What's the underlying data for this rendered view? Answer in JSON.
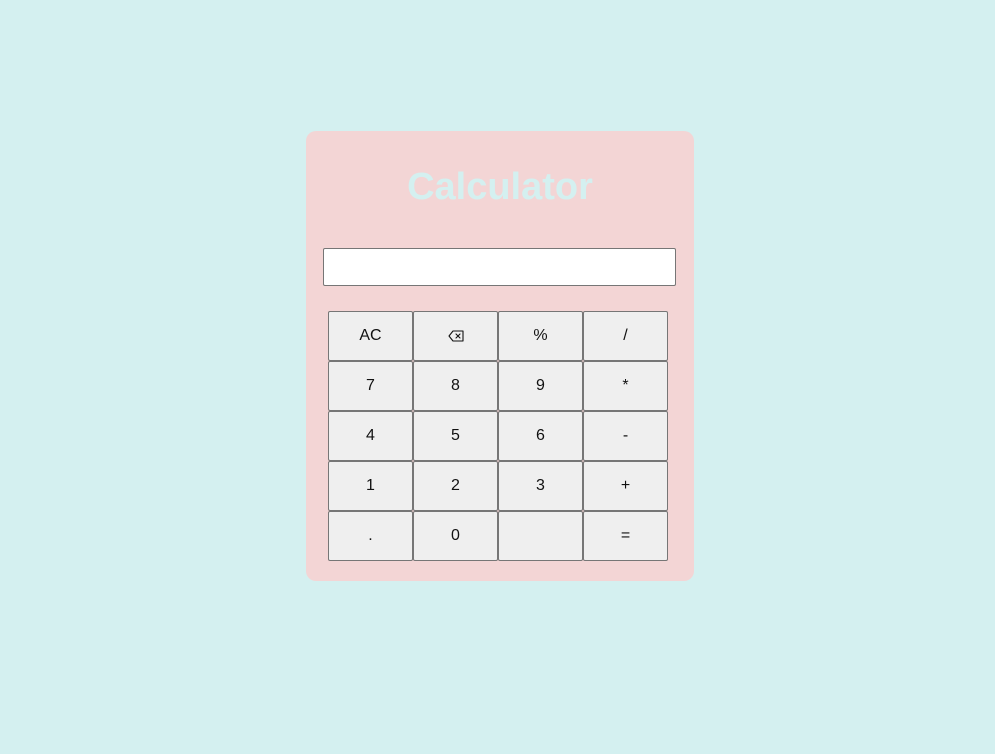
{
  "app": {
    "title": "Calculator"
  },
  "display": {
    "value": "",
    "placeholder": ""
  },
  "keys": [
    {
      "label": "AC",
      "name": "clear-button"
    },
    {
      "label": "",
      "name": "backspace-button",
      "icon": "backspace-icon"
    },
    {
      "label": "%",
      "name": "percent-button"
    },
    {
      "label": "/",
      "name": "divide-button"
    },
    {
      "label": "7",
      "name": "digit-7-button"
    },
    {
      "label": "8",
      "name": "digit-8-button"
    },
    {
      "label": "9",
      "name": "digit-9-button"
    },
    {
      "label": "*",
      "name": "multiply-button"
    },
    {
      "label": "4",
      "name": "digit-4-button"
    },
    {
      "label": "5",
      "name": "digit-5-button"
    },
    {
      "label": "6",
      "name": "digit-6-button"
    },
    {
      "label": "-",
      "name": "subtract-button"
    },
    {
      "label": "1",
      "name": "digit-1-button"
    },
    {
      "label": "2",
      "name": "digit-2-button"
    },
    {
      "label": "3",
      "name": "digit-3-button"
    },
    {
      "label": "+",
      "name": "add-button"
    },
    {
      "label": ".",
      "name": "decimal-button"
    },
    {
      "label": "0",
      "name": "digit-0-button"
    },
    {
      "label": "",
      "name": "blank-button"
    },
    {
      "label": "=",
      "name": "equals-button"
    }
  ],
  "colors": {
    "background": "#d4f0f0",
    "panel": "#f3d5d5",
    "title": "#d4f0f0",
    "key_background": "#efefef",
    "key_border": "#767676"
  }
}
